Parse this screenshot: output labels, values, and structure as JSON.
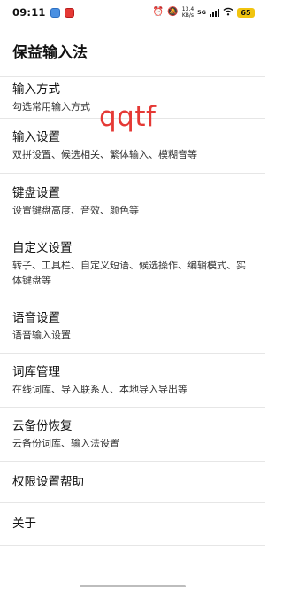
{
  "status_bar": {
    "time": "09:11",
    "net_speed_value": "13.4",
    "net_speed_unit": "KB/s",
    "network_type": "5G",
    "battery": "65"
  },
  "header": {
    "title": "保益输入法"
  },
  "overlay": {
    "text": "qqtf"
  },
  "items": [
    {
      "title": "输入方式",
      "desc": "勾选常用输入方式"
    },
    {
      "title": "输入设置",
      "desc": "双拼设置、候选相关、繁体输入、模糊音等"
    },
    {
      "title": "键盘设置",
      "desc": "设置键盘高度、音效、颜色等"
    },
    {
      "title": "自定义设置",
      "desc": "转子、工具栏、自定义短语、候选操作、编辑模式、实体键盘等"
    },
    {
      "title": "语音设置",
      "desc": "语音输入设置"
    },
    {
      "title": "词库管理",
      "desc": "在线词库、导入联系人、本地导入导出等"
    },
    {
      "title": "云备份恢复",
      "desc": "云备份词库、输入法设置"
    },
    {
      "title": "权限设置帮助"
    },
    {
      "title": "关于"
    }
  ]
}
